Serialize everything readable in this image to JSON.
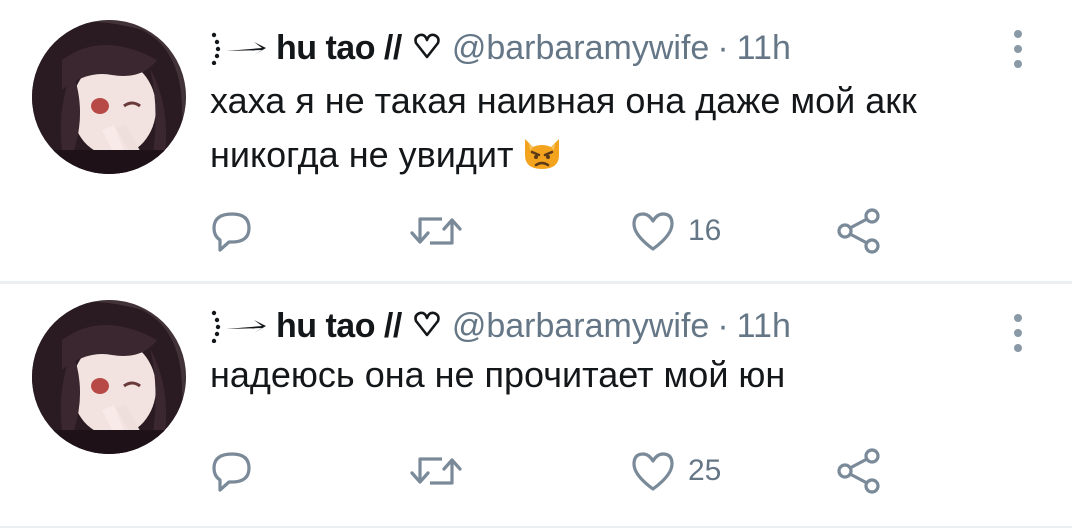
{
  "colors": {
    "text_primary": "#14171a",
    "text_secondary": "#657786",
    "icon": "#7a8a99",
    "divider": "#eceff1",
    "emoji": "#f4a31e"
  },
  "tweets": [
    {
      "display_name": "hu tao //",
      "handle": "@barbaramywife",
      "separator": "·",
      "timestamp": "11h",
      "text": "хаха я не такая наивная она даже мой акк никогда не увидит",
      "emoji": "pouting-cat-emoji",
      "likes": "16",
      "icons": [
        "reply-icon",
        "retweet-icon",
        "heart-icon",
        "share-icon",
        "more-icon"
      ]
    },
    {
      "display_name": "hu tao //",
      "handle": "@barbaramywife",
      "separator": "·",
      "timestamp": "11h",
      "text": "надеюсь она не прочитает мой юн",
      "likes": "25",
      "icons": [
        "reply-icon",
        "retweet-icon",
        "heart-icon",
        "share-icon",
        "more-icon"
      ]
    }
  ]
}
